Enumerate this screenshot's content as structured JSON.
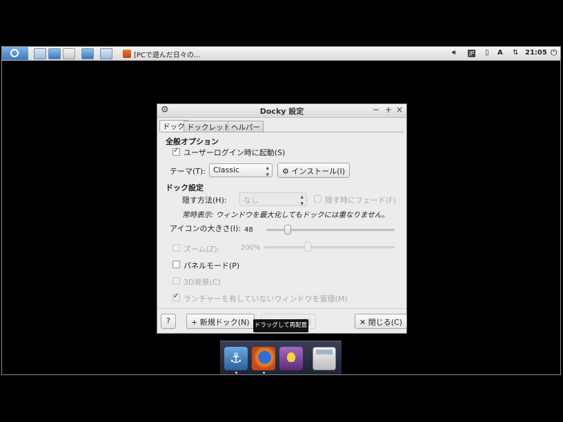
{
  "panel": {
    "taskbar_item": "[PCで遊んだ日々の...",
    "clock": "21:05",
    "tray_badge": "JP"
  },
  "dialog": {
    "title": "Docky 設定",
    "title_buttons": [
      "−",
      "+",
      "×"
    ],
    "tabs": [
      "ドック",
      "ドックレット",
      "ヘルパー"
    ],
    "section_general": "全般オプション",
    "start_at_login_label": "ユーザーログイン時に起動(S)",
    "theme_label": "テーマ(T):",
    "theme_value": "Classic",
    "install_button": "インストール(I)",
    "section_dock": "ドック設定",
    "hide_label": "隠す方法(H):",
    "hide_value": "なし",
    "fade_label": "隠す時にフェード(F)",
    "info_text": "常時表示: ウィンドウを最大化してもドックには重なりません。",
    "icon_size_label": "アイコンの大きさ(I):",
    "icon_size_value": "48",
    "icon_size_fraction": 0.15,
    "zoom_label": "ズーム(Z):",
    "zoom_value": "200%",
    "zoom_fraction": 0.33,
    "panel_mode_label": "パネルモード(P)",
    "bg3d_label": "3D背景(C)",
    "manage_label": "ランチャーを有していないウィンドウを管理(M)",
    "help_button": "?",
    "new_dock_button": "新規ドック(N)",
    "hidden_button_partial": "ドックを削除",
    "close_button": "閉じる(C)"
  },
  "tooltip": "ドラッグして再配置",
  "dock": {
    "items": [
      "anchor-docky",
      "firefox",
      "pidgin",
      "calculator"
    ]
  }
}
